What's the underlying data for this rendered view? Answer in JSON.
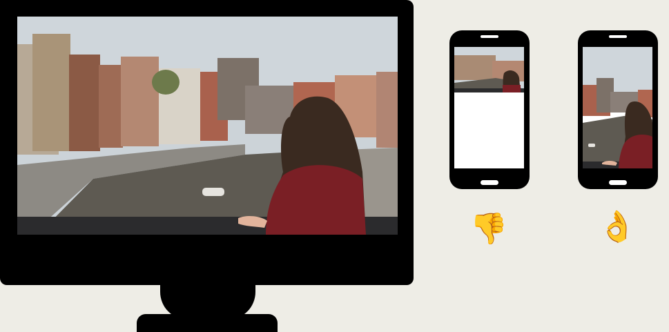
{
  "scene": {
    "description_icons": {
      "bad": "thumbs-down-icon",
      "good": "ok-hand-icon"
    },
    "colors": {
      "background": "#eeede6",
      "device": "#000000",
      "sky": "#ccd3d8",
      "water": "#5e5a52",
      "jacket": "#7a1f25",
      "hair": "#3a2a20"
    }
  },
  "verdicts": {
    "bad_glyph": "👎",
    "good_glyph": "👌"
  }
}
